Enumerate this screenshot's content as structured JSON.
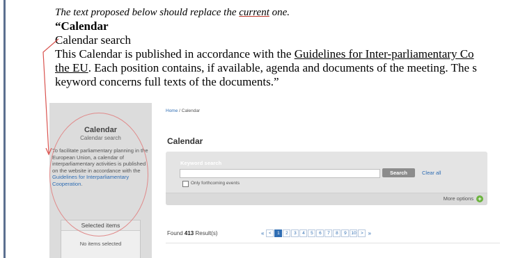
{
  "document": {
    "intro_a": "The text proposed below should replace the ",
    "intro_u": "current",
    "intro_b": " one.",
    "heading": "“Calendar",
    "subheading": "Calendar search",
    "para_line1_a": "This Calendar is published in accordance with the ",
    "para_line1_u": "Guidelines for Inter-parliamentary Co",
    "para_line2_u": "the EU",
    "para_line2_b": ". Each position contains, if available, agenda and documents of the meeting. The s",
    "para_line3": "keyword concerns full texts of the documents.”"
  },
  "sidebar": {
    "title": "Calendar",
    "subtitle": "Calendar search",
    "text_a": "To facilitate parliamentary planning in the European Union, a calendar of interparliamentary activities is published on the website in accordance with the ",
    "text_link": "Guidelines for Interparliamentary Cooperation",
    "text_b": ".",
    "selected_header": "Selected items",
    "selected_empty": "No items selected"
  },
  "breadcrumb": {
    "home": "Home",
    "sep": " / ",
    "current": "Calendar"
  },
  "main": {
    "title": "Calendar",
    "keyword_label": "Keyword search",
    "search_button": "Search",
    "clear_link": "Clear all",
    "checkbox_label": "Only forthcoming events",
    "more_options": "More options",
    "found_prefix": "Found ",
    "found_count": "413",
    "found_suffix": " Result(s)"
  },
  "pagination": {
    "first": "«",
    "prev": "<",
    "pages": [
      "1",
      "2",
      "3",
      "4",
      "5",
      "6",
      "7",
      "8",
      "9",
      "10"
    ],
    "current_page": "1",
    "next": ">",
    "last": "»"
  },
  "colors": {
    "annotation": "#d9534f",
    "link": "#2f6db3",
    "more_icon": "#6bb33e"
  },
  "icons": {
    "more_options": "plus-circle-icon"
  }
}
